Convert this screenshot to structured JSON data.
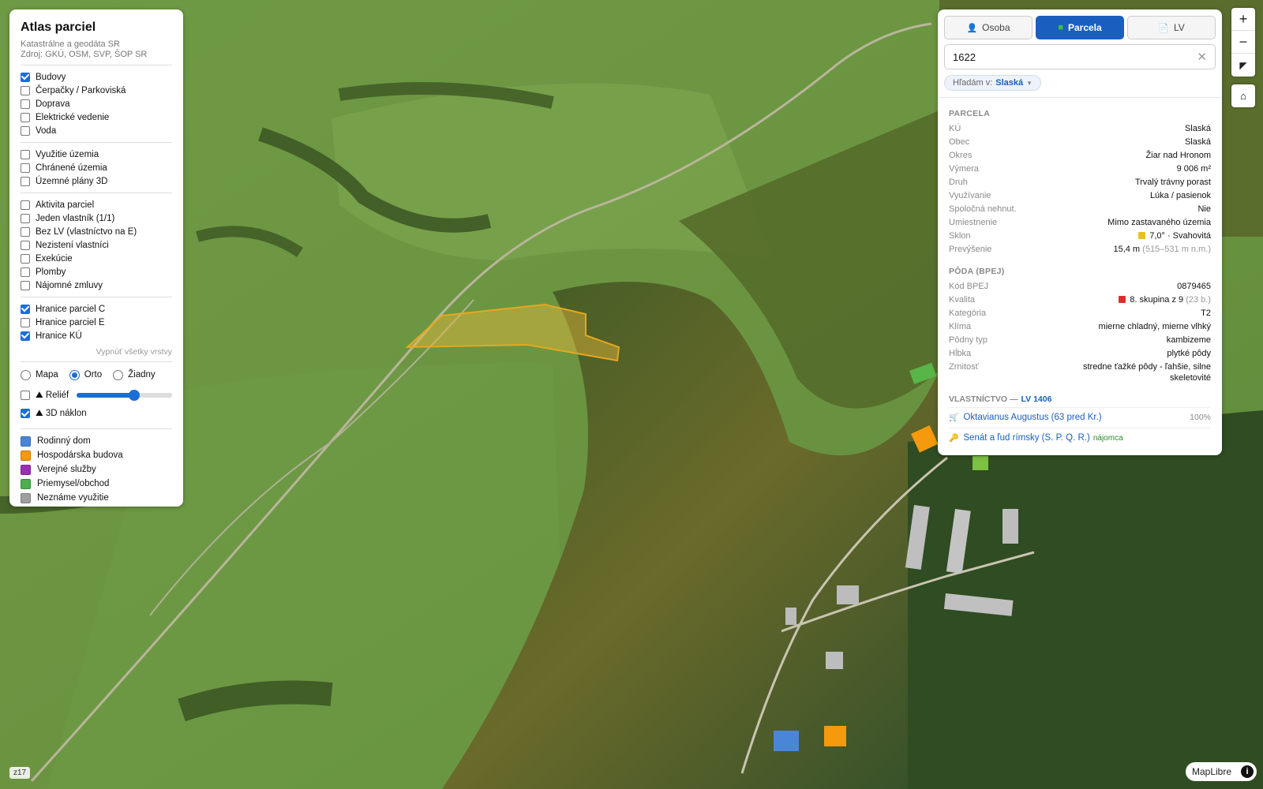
{
  "app": {
    "title": "Atlas parciel",
    "subtitle1": "Katastrálne a geodáta SR",
    "subtitle2": "Zdroj: GKÚ, OSM, SVP, ŠOP SR"
  },
  "layers": {
    "group1": [
      {
        "label": "Budovy",
        "checked": true
      },
      {
        "label": "Čerpačky / Parkoviská",
        "checked": false
      },
      {
        "label": "Doprava",
        "checked": false
      },
      {
        "label": "Elektrické vedenie",
        "checked": false
      },
      {
        "label": "Voda",
        "checked": false
      }
    ],
    "group2": [
      {
        "label": "Využitie územia",
        "checked": false
      },
      {
        "label": "Chránené územia",
        "checked": false
      },
      {
        "label": "Územné plány 3D",
        "checked": false
      }
    ],
    "group3": [
      {
        "label": "Aktivita parciel",
        "checked": false
      },
      {
        "label": "Jeden vlastník (1/1)",
        "checked": false
      },
      {
        "label": "Bez LV (vlastníctvo na E)",
        "checked": false
      },
      {
        "label": "Nezistení vlastníci",
        "checked": false
      },
      {
        "label": "Exekúcie",
        "checked": false
      },
      {
        "label": "Plomby",
        "checked": false
      },
      {
        "label": "Nájomné zmluvy",
        "checked": false
      }
    ],
    "group4": [
      {
        "label": "Hranice parciel C",
        "checked": true
      },
      {
        "label": "Hranice parciel E",
        "checked": false
      },
      {
        "label": "Hranice KÚ",
        "checked": true
      }
    ],
    "turn_off_all": "Vypnúť všetky vrstvy"
  },
  "basemap": {
    "options": [
      {
        "label": "Mapa",
        "selected": false
      },
      {
        "label": "Orto",
        "selected": true
      },
      {
        "label": "Žiadny",
        "selected": false
      }
    ],
    "relief_label": "⛰ Reliéf",
    "relief_checked": false,
    "relief_value": 0.6,
    "tilt_label": "⛰ 3D náklon",
    "tilt_checked": true
  },
  "legend": [
    {
      "label": "Rodinný dom",
      "color": "#4a86d8"
    },
    {
      "label": "Hospodárska budova",
      "color": "#f59a0c"
    },
    {
      "label": "Verejné služby",
      "color": "#9b2fb5"
    },
    {
      "label": "Priemysel/obchod",
      "color": "#4cae4c"
    },
    {
      "label": "Neznáme využitie",
      "color": "#9e9e9e"
    }
  ],
  "tabs": [
    {
      "label": "Osoba",
      "icon": "person-icon",
      "glyph": "👤",
      "active": false
    },
    {
      "label": "Parcela",
      "icon": "parcel-icon",
      "glyph": "■",
      "active": true
    },
    {
      "label": "LV",
      "icon": "document-icon",
      "glyph": "📄",
      "active": false
    }
  ],
  "search": {
    "value": "1622",
    "scope_label": "Hľadám v:",
    "scope_value": "Slaská"
  },
  "parcela": {
    "title": "PARCELA",
    "rows": [
      {
        "k": "KÚ",
        "v": "Slaská"
      },
      {
        "k": "Obec",
        "v": "Slaská"
      },
      {
        "k": "Okres",
        "v": "Žiar nad Hronom"
      },
      {
        "k": "Výmera",
        "v": "9 006 m²"
      },
      {
        "k": "Druh",
        "v": "Trvalý trávny porast"
      },
      {
        "k": "Využívanie",
        "v": "Lúka / pasienok"
      },
      {
        "k": "Spoločná nehnut.",
        "v": "Nie"
      },
      {
        "k": "Umiestnenie",
        "v": "Mimo zastavaného územia"
      }
    ],
    "sklon_label": "Sklon",
    "sklon_value": "7,0° · Svahovitá",
    "sklon_color": "#e8c21c",
    "prev_label": "Prevýšenie",
    "prev_value": "15,4 m",
    "prev_extra": "(515–531 m n.m.)"
  },
  "poda": {
    "title": "PÔDA (BPEJ)",
    "kod_label": "Kód BPEJ",
    "kod_value": "0879465",
    "kvalita_label": "Kvalita",
    "kvalita_value": "8. skupina z 9",
    "kvalita_extra": "(23 b.)",
    "kvalita_color": "#d9302c",
    "rows": [
      {
        "k": "Kategória",
        "v": "T2"
      },
      {
        "k": "Klíma",
        "v": "mierne chladný, mierne vlhký"
      },
      {
        "k": "Pôdny typ",
        "v": "kambizeme"
      },
      {
        "k": "Hĺbka",
        "v": "plytké pôdy"
      },
      {
        "k": "Zrnitosť",
        "v": "stredne ťažké pôdy - ľahšie, silne skeletovité"
      }
    ]
  },
  "ownership": {
    "title": "VLASTNÍCTVO —",
    "lv": "LV 1406",
    "owners": [
      {
        "icon": "cart-icon",
        "glyph": "🛒",
        "name": "Oktavianus Augustus (63 pred Kr.)",
        "share": "100%",
        "role": ""
      },
      {
        "icon": "key-icon",
        "glyph": "🔑",
        "name": "Senát a ľud rímsky (S. P. Q. R.)",
        "share": "",
        "role": "nájomca"
      }
    ]
  },
  "map": {
    "zoom_label": "z17",
    "attribution": "MapLibre",
    "parcel_fill": "#e8b93a",
    "controls": {
      "zoom_in": "+",
      "zoom_out": "−",
      "compass": "◤",
      "home": "⌂"
    }
  }
}
